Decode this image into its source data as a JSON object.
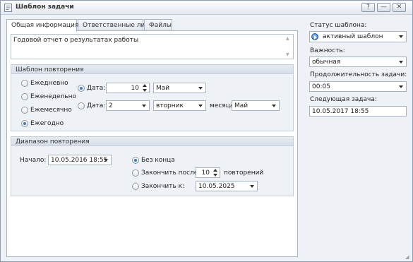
{
  "window": {
    "title": "Шаблон задачи",
    "controls": {
      "help": "?",
      "minimize": "—",
      "close": "✕"
    }
  },
  "tabs": [
    {
      "label": "Общая информация",
      "active": true
    },
    {
      "label": "Ответственные лица",
      "active": false
    },
    {
      "label": "Файлы",
      "active": false
    }
  ],
  "general": {
    "description": "Годовой отчет о результатах работы"
  },
  "recurrence": {
    "title": "Шаблон повторения",
    "options": [
      "Ежедневно",
      "Еженедельно",
      "Ежемесячно",
      "Ежегодно"
    ],
    "selected": "Ежегодно",
    "date_label": "Дата:",
    "date_option1": {
      "day": "10",
      "month": "Май"
    },
    "date_option2": {
      "ordinal": "2",
      "weekday": "вторник",
      "month_label": "месяца",
      "month": "Май"
    }
  },
  "range": {
    "title": "Диапазон повторения",
    "start_label": "Начало:",
    "start_value": "10.05.2016 18:55",
    "no_end_label": "Без конца",
    "end_after_label": "Закончить после:",
    "end_after_value": "10",
    "end_after_suffix": "повторений",
    "end_by_label": "Закончить к:",
    "end_by_value": "10.05.2025",
    "selected": "Без конца"
  },
  "sidebar": {
    "status_label": "Статус шаблона:",
    "status_value": "активный шаблон",
    "importance_label": "Важность:",
    "importance_value": "обычная",
    "duration_label": "Продолжительность задачи:",
    "duration_value": "00:05",
    "next_label": "Следующая задача:",
    "next_value": "10.05.2017 18:55"
  },
  "colors": {
    "accent": "#3a77c9",
    "window_bg": "#eef1f6",
    "border": "#a8b3c4"
  }
}
